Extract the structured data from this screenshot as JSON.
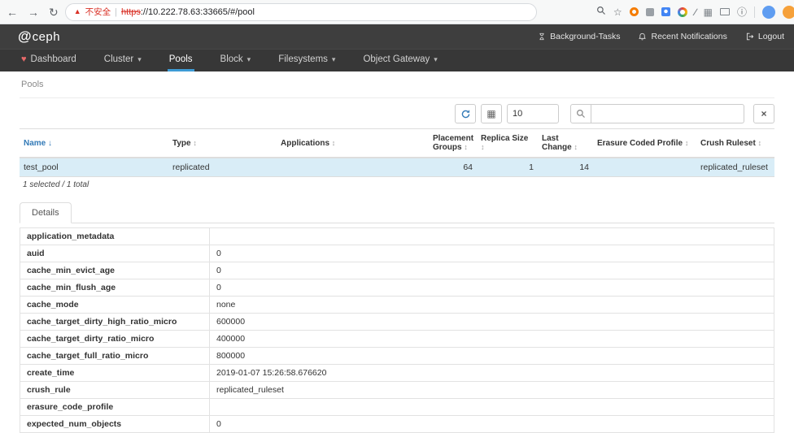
{
  "colors": {
    "accent_blue": "#3d9bd5",
    "link_blue": "#337ab7",
    "header_dark": "#3e3e3e",
    "nav_dark": "#373737",
    "selected_row": "#d9edf7",
    "danger_red": "#d93025",
    "heart_red": "#e96a6a"
  },
  "browser": {
    "back_icon": "←",
    "forward_icon": "→",
    "reload_icon": "↻",
    "warning_icon": "▲",
    "security_label": "不安全",
    "separator": "|",
    "url_protocol": "https",
    "url_rest": "://10.222.78.63:33665/#/pool",
    "star_icon": "☆",
    "pencil_icon": "∕",
    "grid_icon": "▦",
    "info_icon": "ⓘ"
  },
  "header": {
    "logo_symbol": "@",
    "logo_text": "ceph",
    "background_tasks_label": "Background-Tasks",
    "notifications_label": "Recent Notifications",
    "logout_label": "Logout"
  },
  "nav": {
    "heart_icon": "♥",
    "caret_icon": "▾",
    "items": [
      {
        "label": "Dashboard"
      },
      {
        "label": "Cluster"
      },
      {
        "label": "Pools"
      },
      {
        "label": "Block"
      },
      {
        "label": "Filesystems"
      },
      {
        "label": "Object Gateway"
      }
    ]
  },
  "breadcrumb": "Pools",
  "toolbar": {
    "grid_icon": "▦",
    "page_size": "10",
    "search_placeholder": "",
    "clear_label": "×"
  },
  "pool_table": {
    "sort_active_icon": "↓",
    "sort_icon": "↕",
    "columns": [
      {
        "label": "Name"
      },
      {
        "label": "Type"
      },
      {
        "label": "Applications"
      },
      {
        "label": "Placement Groups"
      },
      {
        "label": "Replica Size"
      },
      {
        "label": "Last Change"
      },
      {
        "label": "Erasure Coded Profile"
      },
      {
        "label": "Crush Ruleset"
      }
    ],
    "rows": [
      {
        "name": "test_pool",
        "type": "replicated",
        "applications": "",
        "placement_groups": "64",
        "replica_size": "1",
        "last_change": "14",
        "erasure_coded_profile": "",
        "crush_ruleset": "replicated_ruleset"
      }
    ],
    "footer": "1 selected / 1 total"
  },
  "details": {
    "tab_label": "Details",
    "rows": [
      {
        "key": "application_metadata",
        "value": ""
      },
      {
        "key": "auid",
        "value": "0"
      },
      {
        "key": "cache_min_evict_age",
        "value": "0"
      },
      {
        "key": "cache_min_flush_age",
        "value": "0"
      },
      {
        "key": "cache_mode",
        "value": "none"
      },
      {
        "key": "cache_target_dirty_high_ratio_micro",
        "value": "600000"
      },
      {
        "key": "cache_target_dirty_ratio_micro",
        "value": "400000"
      },
      {
        "key": "cache_target_full_ratio_micro",
        "value": "800000"
      },
      {
        "key": "create_time",
        "value": "2019-01-07 15:26:58.676620"
      },
      {
        "key": "crush_rule",
        "value": "replicated_ruleset"
      },
      {
        "key": "erasure_code_profile",
        "value": ""
      },
      {
        "key": "expected_num_objects",
        "value": "0"
      }
    ]
  }
}
